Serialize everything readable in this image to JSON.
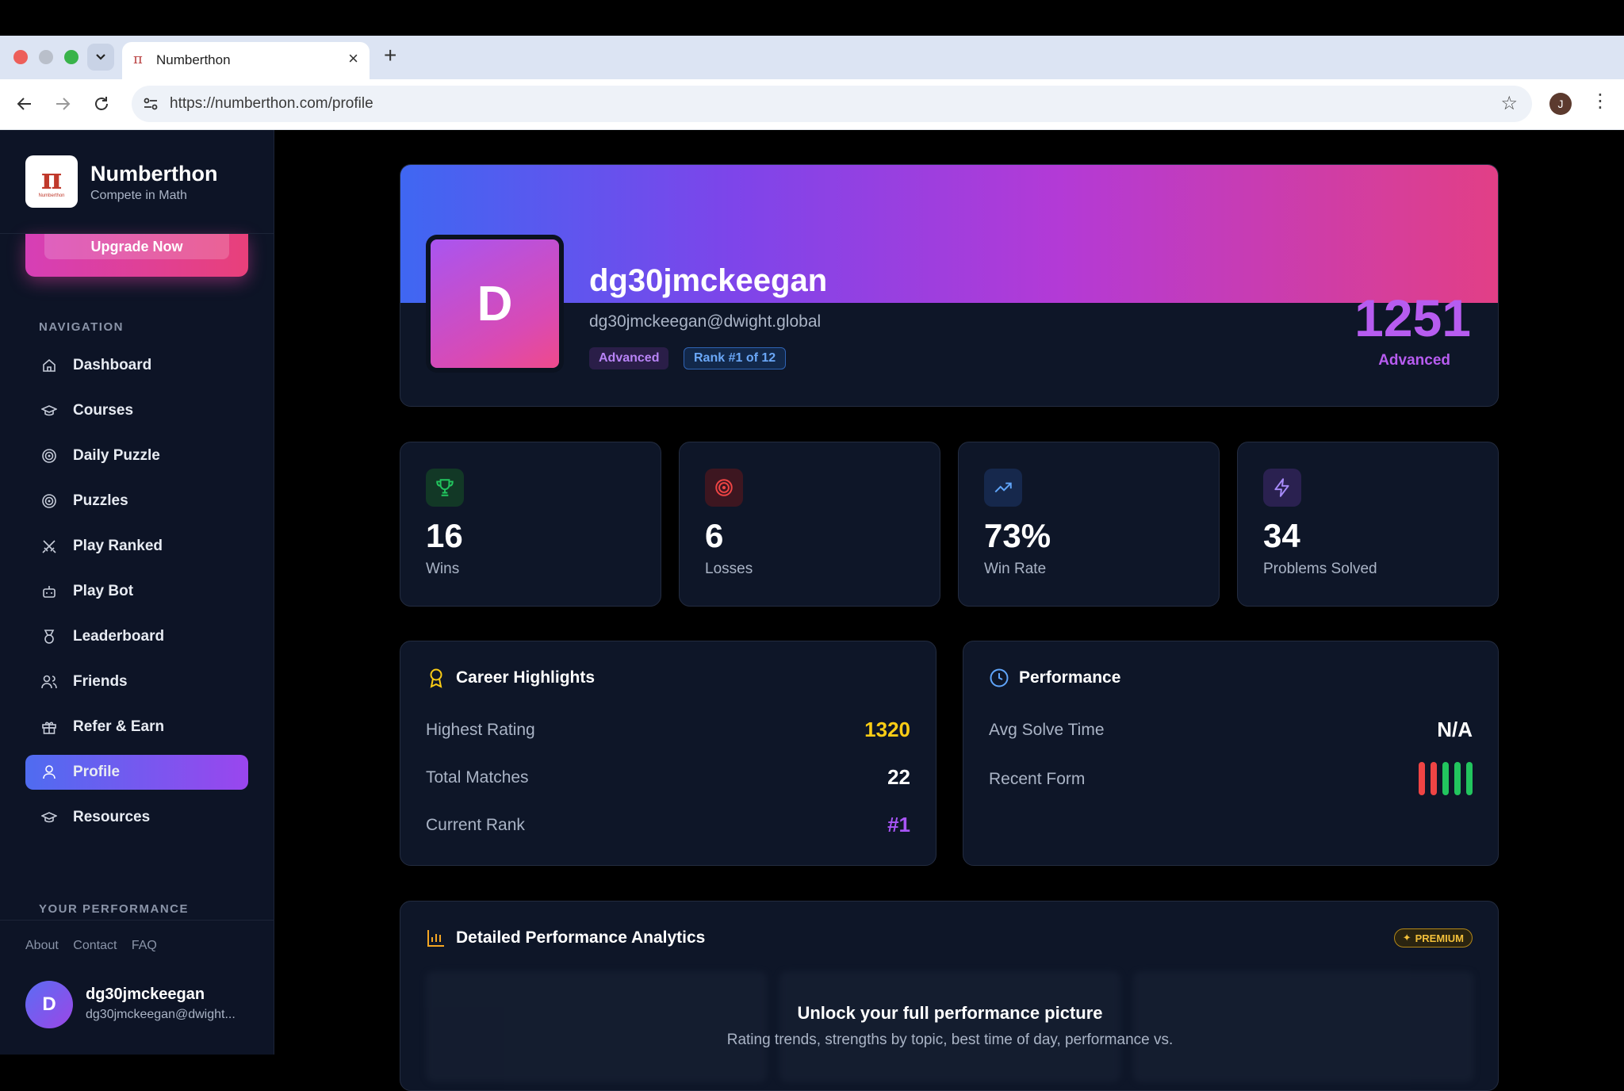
{
  "browser": {
    "tab_title": "Numberthon",
    "tab_favicon": "π",
    "url": "https://numberthon.com/profile",
    "profile_initial": "J"
  },
  "sidebar": {
    "brand_mark": "π",
    "brand_mini": "Numberthon",
    "brand_name": "Numberthon",
    "brand_tagline": "Compete in Math",
    "upgrade_label": "Upgrade Now",
    "nav_heading": "NAVIGATION",
    "items": [
      {
        "label": "Dashboard",
        "icon": "home-icon"
      },
      {
        "label": "Courses",
        "icon": "graduation-cap-icon"
      },
      {
        "label": "Daily Puzzle",
        "icon": "target-icon"
      },
      {
        "label": "Puzzles",
        "icon": "target-icon"
      },
      {
        "label": "Play Ranked",
        "icon": "swords-icon"
      },
      {
        "label": "Play Bot",
        "icon": "bot-icon"
      },
      {
        "label": "Leaderboard",
        "icon": "medal-icon"
      },
      {
        "label": "Friends",
        "icon": "users-icon"
      },
      {
        "label": "Refer & Earn",
        "icon": "gift-icon"
      },
      {
        "label": "Profile",
        "icon": "user-icon",
        "active": true
      },
      {
        "label": "Resources",
        "icon": "graduation-cap-icon"
      }
    ],
    "performance_heading": "YOUR PERFORMANCE",
    "footer_links": [
      "About",
      "Contact",
      "FAQ"
    ],
    "user": {
      "initial": "D",
      "name": "dg30jmckeegan",
      "email": "dg30jmckeegan@dwight..."
    }
  },
  "profile": {
    "initial": "D",
    "username": "dg30jmckeegan",
    "email": "dg30jmckeegan@dwight.global",
    "badge_level": "Advanced",
    "badge_rank": "Rank #1 of 12",
    "rating": "1251",
    "rating_tier": "Advanced"
  },
  "stats": [
    {
      "value": "16",
      "label": "Wins",
      "icon": "trophy-icon",
      "color": "#22c55e"
    },
    {
      "value": "6",
      "label": "Losses",
      "icon": "target-icon",
      "color": "#ef4444"
    },
    {
      "value": "73%",
      "label": "Win Rate",
      "icon": "trending-up-icon",
      "color": "#60a5fa"
    },
    {
      "value": "34",
      "label": "Problems Solved",
      "icon": "bolt-icon",
      "color": "#a78bfa"
    }
  ],
  "career": {
    "title": "Career Highlights",
    "rows": [
      {
        "label": "Highest Rating",
        "value": "1320",
        "color": "#facc15"
      },
      {
        "label": "Total Matches",
        "value": "22",
        "color": "#ffffff"
      },
      {
        "label": "Current Rank",
        "value": "#1",
        "color": "#a855f7"
      }
    ]
  },
  "performance": {
    "title": "Performance",
    "avg_solve_label": "Avg Solve Time",
    "avg_solve_value": "N/A",
    "recent_form_label": "Recent Form",
    "recent_form": [
      "L",
      "L",
      "W",
      "W",
      "W"
    ]
  },
  "analytics": {
    "title": "Detailed Performance Analytics",
    "premium_label": "PREMIUM",
    "lock_title": "Unlock your full performance picture",
    "lock_subtitle": "Rating trends, strengths by topic, best time of day, performance vs."
  },
  "colors": {
    "accent": "#9a46ee",
    "win": "#22c55e",
    "loss": "#ef4444"
  }
}
